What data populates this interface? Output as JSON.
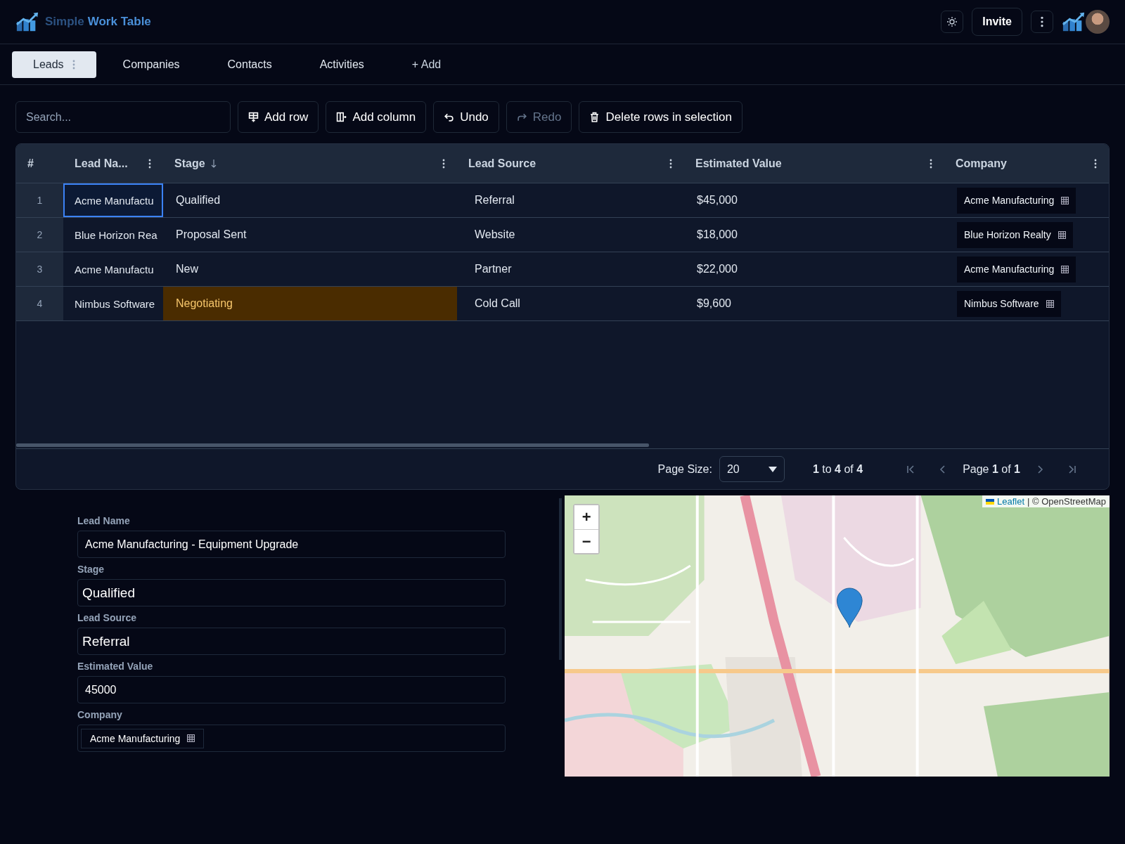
{
  "header": {
    "brand_first": "Simple",
    "brand_second": "Work Table",
    "invite_label": "Invite"
  },
  "tabs": [
    {
      "label": "Leads",
      "selected": true
    },
    {
      "label": "Companies",
      "selected": false
    },
    {
      "label": "Contacts",
      "selected": false
    },
    {
      "label": "Activities",
      "selected": false
    }
  ],
  "add_tab_label": "+ Add",
  "search": {
    "placeholder": "Search..."
  },
  "toolbar": [
    {
      "kind": "add-row",
      "label": "Add row",
      "disabled": false
    },
    {
      "kind": "add-column",
      "label": "Add column",
      "disabled": false
    },
    {
      "kind": "undo",
      "label": "Undo",
      "disabled": false
    },
    {
      "kind": "redo",
      "label": "Redo",
      "disabled": true
    },
    {
      "kind": "delete",
      "label": "Delete rows in selection",
      "disabled": false
    }
  ],
  "table": {
    "columns": [
      {
        "label": "#",
        "menu": false
      },
      {
        "label": "Lead Na...",
        "menu": true
      },
      {
        "label": "Stage",
        "menu": true,
        "sorted_descending": true
      },
      {
        "label": "Lead Source",
        "menu": true
      },
      {
        "label": "Estimated Value",
        "menu": true
      },
      {
        "label": "Company",
        "menu": true
      }
    ],
    "rows": [
      {
        "number": "1",
        "lead_name": "Acme Manufactu",
        "stage": "Qualified",
        "lead_source": "Referral",
        "estimated_value": "$45,000",
        "company": "Acme Manufacturing",
        "focused": true,
        "stage_highlighted": false
      },
      {
        "number": "2",
        "lead_name": "Blue Horizon Rea",
        "stage": "Proposal Sent",
        "lead_source": "Website",
        "estimated_value": "$18,000",
        "company": "Blue Horizon Realty",
        "focused": false,
        "stage_highlighted": false
      },
      {
        "number": "3",
        "lead_name": "Acme Manufactu",
        "stage": "New",
        "lead_source": "Partner",
        "estimated_value": "$22,000",
        "company": "Acme Manufacturing",
        "focused": false,
        "stage_highlighted": false
      },
      {
        "number": "4",
        "lead_name": "Nimbus Software",
        "stage": "Negotiating",
        "lead_source": "Cold Call",
        "estimated_value": "$9,600",
        "company": "Nimbus Software",
        "focused": false,
        "stage_highlighted": true
      }
    ]
  },
  "pagination": {
    "page_size_label": "Page Size:",
    "page_size": "20",
    "range": "**1** to **4** of **4**",
    "page": "Page **1** of **1**"
  },
  "form": [
    {
      "label": "Lead Name",
      "kind": "text",
      "value": "Acme Manufacturing - Equipment Upgrade"
    },
    {
      "label": "Stage",
      "kind": "select",
      "value": "Qualified"
    },
    {
      "label": "Lead Source",
      "kind": "select",
      "value": "Referral"
    },
    {
      "label": "Estimated Value",
      "kind": "text",
      "value": "45000"
    },
    {
      "label": "Company",
      "kind": "chip",
      "value": "Acme Manufacturing"
    }
  ],
  "map": {
    "zoom_in": "+",
    "zoom_out": "−",
    "attribution_link": "Leaflet",
    "attribution_text": "| © OpenStreetMap"
  }
}
